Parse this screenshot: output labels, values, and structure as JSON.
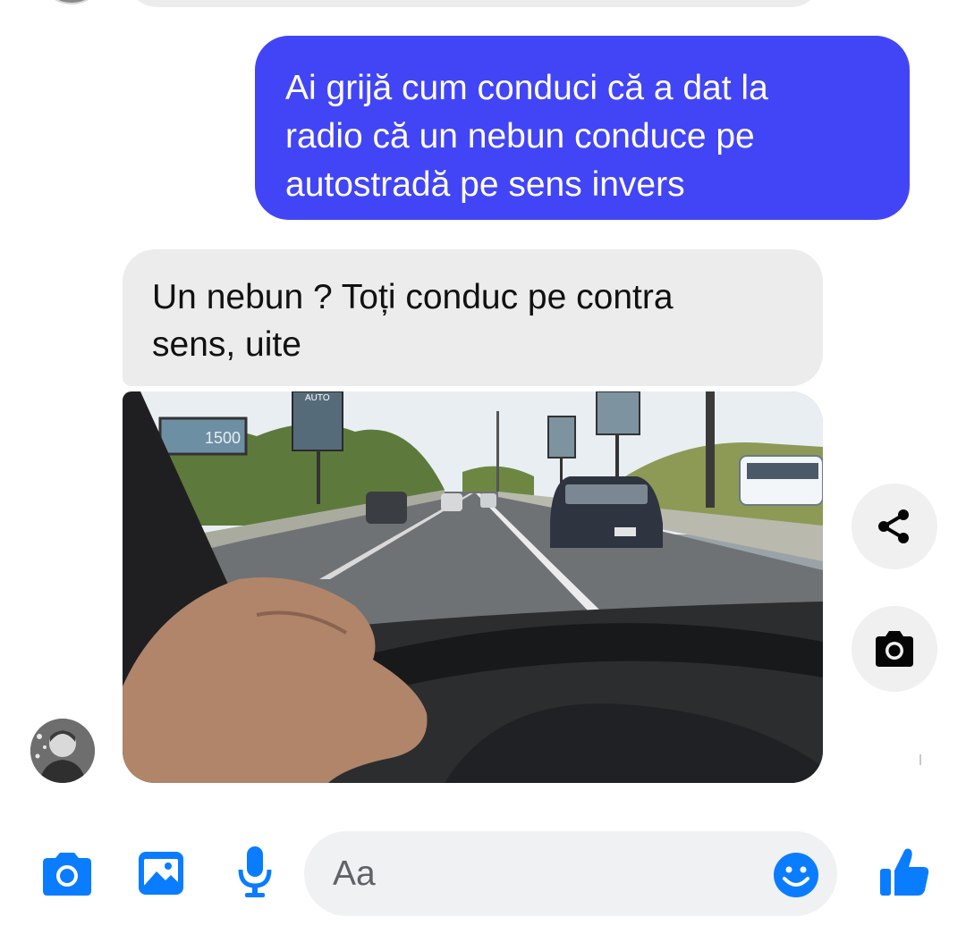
{
  "conversation": {
    "sent_message": {
      "lines": [
        "Ai grijă cum conduci că a dat la",
        "radio că un nebun conduce pe",
        "autostradă pe sens invers"
      ]
    },
    "received_message": {
      "lines": [
        "Un nebun  ? Toți conduc pe contra",
        "sens, uite"
      ]
    },
    "received_image": {
      "billboard_text": "1500",
      "sign_text": "AUTO"
    }
  },
  "actions": {
    "share_icon": "share-icon",
    "camera_icon": "camera-icon"
  },
  "composer": {
    "placeholder": "Aa",
    "icons": [
      "camera-icon",
      "gallery-icon",
      "mic-icon",
      "emoji-icon",
      "like-icon"
    ]
  },
  "colors": {
    "sent_bubble": "#4245f6",
    "received_bubble": "#ececec",
    "accent": "#0a7cff"
  }
}
